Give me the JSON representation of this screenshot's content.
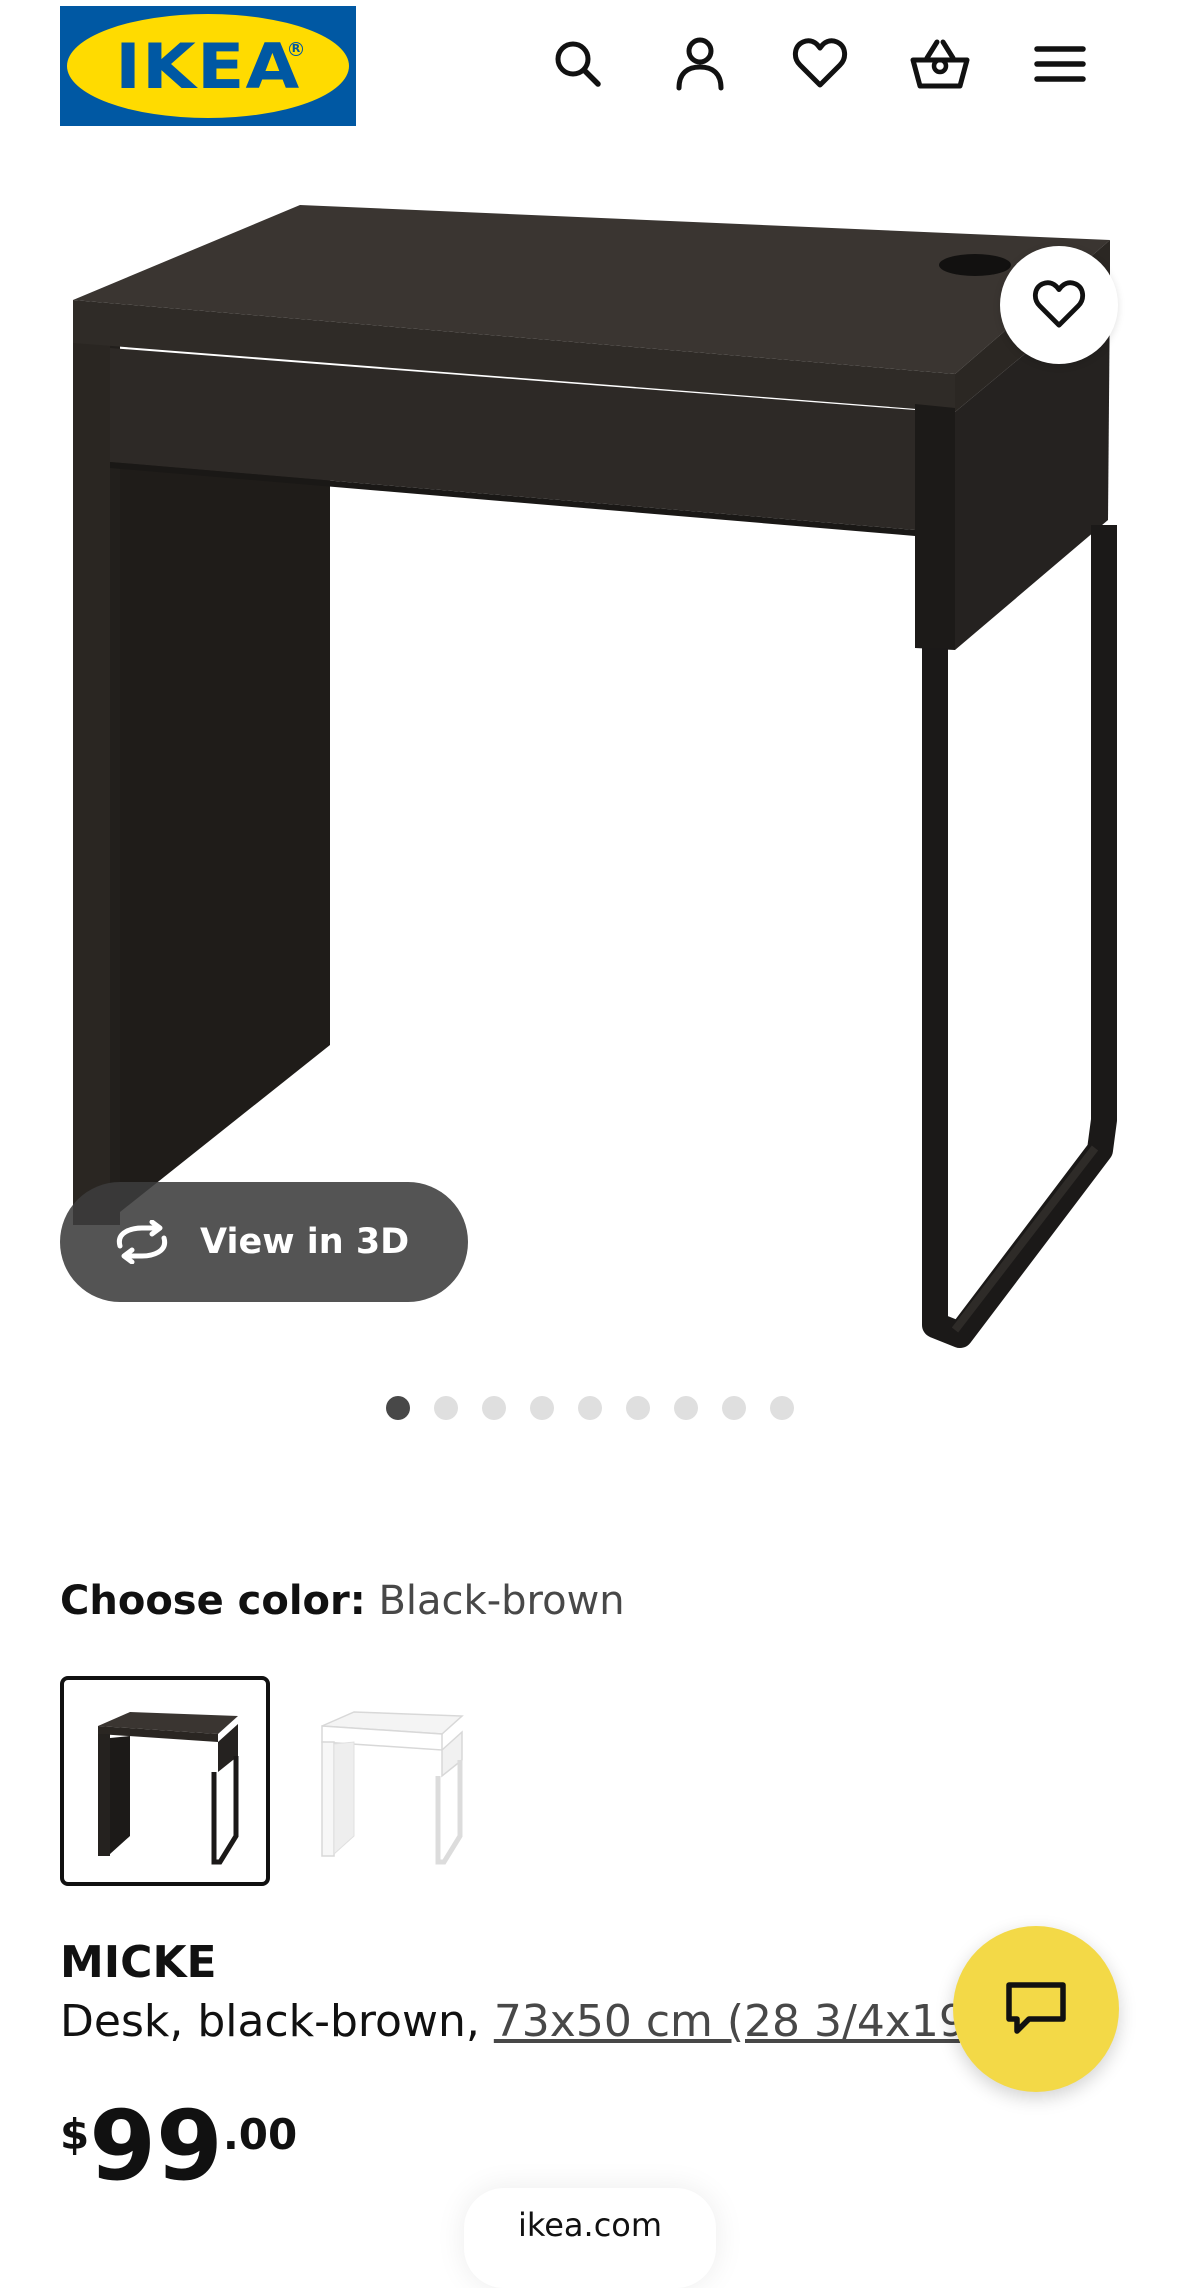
{
  "header": {
    "logo_text": "IKEA",
    "icons": [
      "search-icon",
      "account-icon",
      "favorites-icon",
      "cart-icon",
      "menu-icon"
    ]
  },
  "gallery": {
    "view3d_label": "View in 3D",
    "dot_count": 9,
    "active_dot": 1
  },
  "color_picker": {
    "label": "Choose color:",
    "selected_value": "Black-brown",
    "options": [
      "Black-brown",
      "White"
    ]
  },
  "product": {
    "name": "MICKE",
    "description_prefix": "Desk, black-brown, ",
    "size_link": "73x50 cm (28 3/4x19 ⅝\")",
    "price_currency": "$",
    "price_integer": "99",
    "price_decimal": ".00"
  },
  "browser": {
    "url": "ikea.com"
  },
  "colors": {
    "ikea_blue": "#0058a3",
    "ikea_yellow": "#ffdb00",
    "chat_yellow": "#f3d947",
    "desk_black_brown": "#2c2824"
  }
}
